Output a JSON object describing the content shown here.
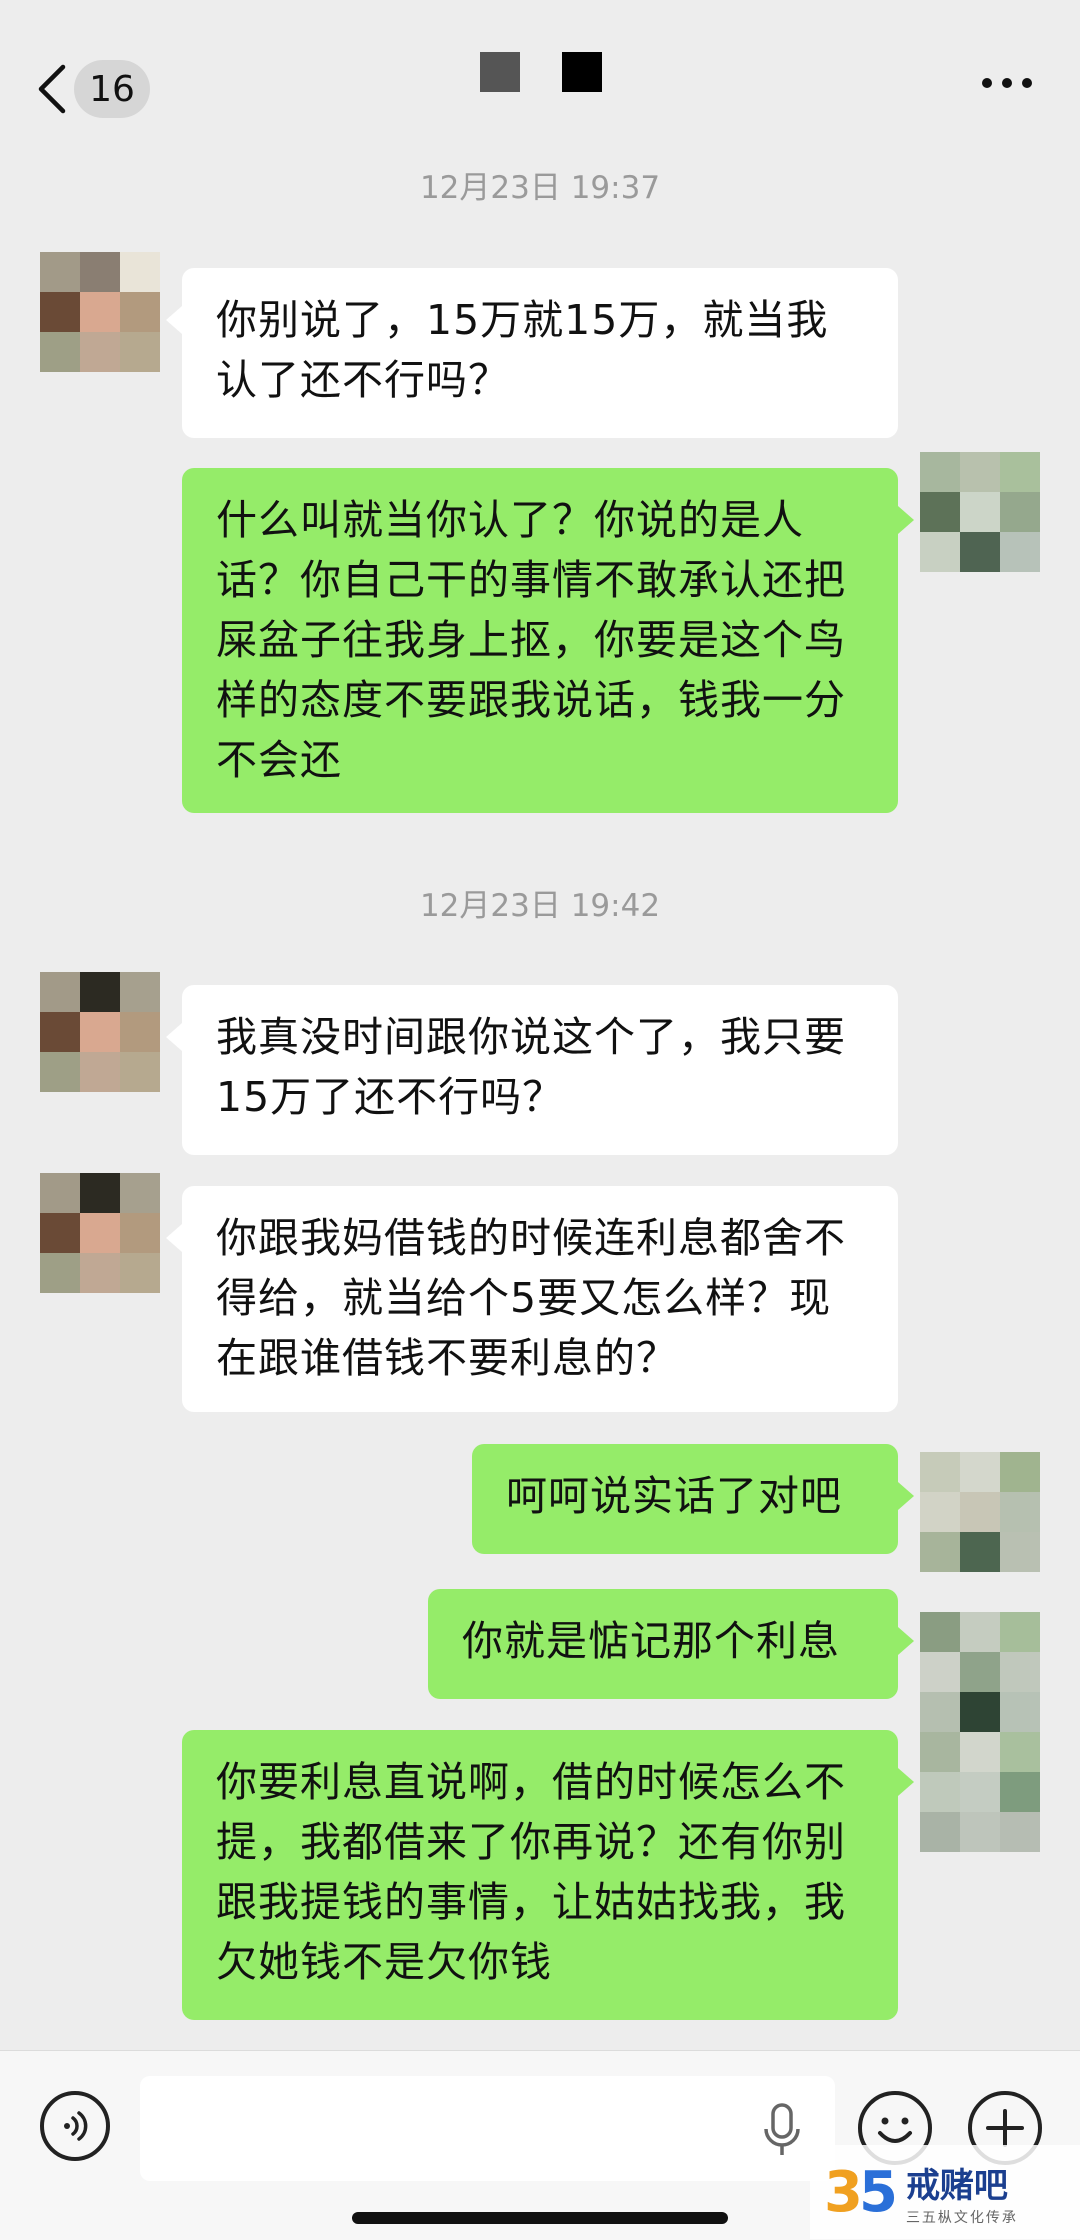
{
  "header": {
    "unread_count": "16",
    "colors": {
      "block1": "#555555",
      "block2": "#000000"
    }
  },
  "timestamps": [
    "12月23日 19:37",
    "12月23日 19:42"
  ],
  "messages": [
    {
      "side": "in",
      "text": "你别说了，15万就15万，就当我认了还不行吗？"
    },
    {
      "side": "out",
      "text": "什么叫就当你认了？你说的是人话？你自己干的事情不敢承认还把屎盆子往我身上抠，你要是这个鸟样的态度不要跟我说话，钱我一分不会还"
    },
    {
      "side": "in",
      "text": "我真没时间跟你说这个了，我只要15万了还不行吗？"
    },
    {
      "side": "in",
      "text": "你跟我妈借钱的时候连利息都舍不得给，就当给个5要又怎么样？现在跟谁借钱不要利息的？"
    },
    {
      "side": "out",
      "text": "呵呵说实话了对吧"
    },
    {
      "side": "out",
      "text": "你就是惦记那个利息"
    },
    {
      "side": "out",
      "text": "你要利息直说啊，借的时候怎么不提，我都借来了你再说？还有你别跟我提钱的事情，让姑姑找我，我欠她钱不是欠你钱"
    }
  ],
  "watermark": {
    "number_a": "3",
    "number_b": "5",
    "title": "戒赌吧",
    "subtitle": "三五枞文化传承"
  },
  "icons": [
    "back-chevron-icon",
    "more-icon",
    "voice-icon",
    "mic-icon",
    "emoji-icon",
    "plus-icon"
  ],
  "theme": {
    "bubble_out": "#95ec69",
    "bubble_in": "#ffffff",
    "background": "#ededed"
  }
}
